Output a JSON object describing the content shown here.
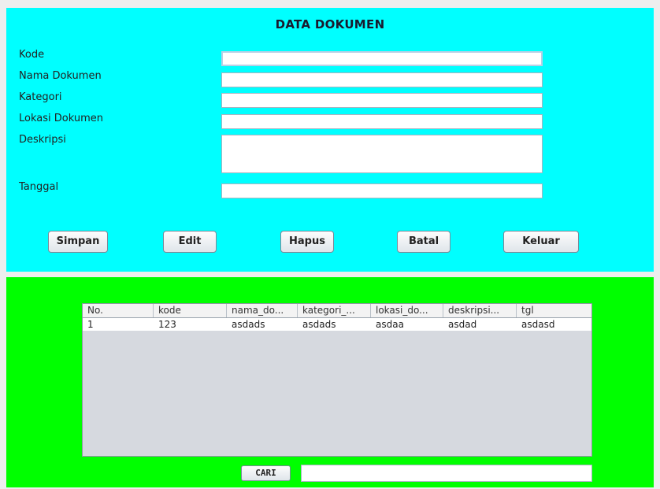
{
  "form": {
    "title": "DATA DOKUMEN",
    "labels": {
      "kode": "Kode",
      "nama": "Nama Dokumen",
      "kategori": "Kategori",
      "lokasi": "Lokasi Dokumen",
      "deskripsi": "Deskripsi",
      "tanggal": "Tanggal"
    },
    "values": {
      "kode": "",
      "nama": "",
      "kategori": "",
      "lokasi": "",
      "deskripsi": "",
      "tanggal": ""
    }
  },
  "buttons": {
    "simpan": "Simpan",
    "edit": "Edit",
    "hapus": "Hapus",
    "batal": "Batal",
    "keluar": "Keluar"
  },
  "table": {
    "headers": [
      "No.",
      "kode",
      "nama_do...",
      "kategori_...",
      "lokasi_do...",
      "deskripsi...",
      "tgl"
    ],
    "rows": [
      [
        "1",
        "123",
        "asdads",
        "asdads",
        "asdaa",
        "asdad",
        "asdasd"
      ]
    ]
  },
  "search": {
    "button_label": "CARI",
    "value": ""
  }
}
